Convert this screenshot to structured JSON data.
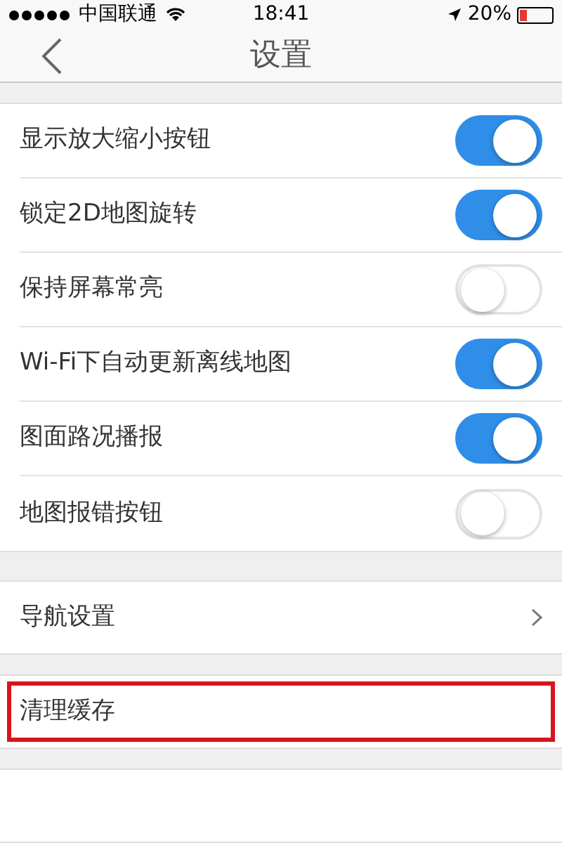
{
  "status_bar": {
    "carrier": "中国联通",
    "time": "18:41",
    "battery": "20%"
  },
  "nav": {
    "title": "设置"
  },
  "toggles": [
    {
      "label": "显示放大缩小按钮",
      "on": true
    },
    {
      "label": "锁定2D地图旋转",
      "on": true
    },
    {
      "label": "保持屏幕常亮",
      "on": false
    },
    {
      "label": "Wi-Fi下自动更新离线地图",
      "on": true
    },
    {
      "label": "图面路况播报",
      "on": true
    },
    {
      "label": "地图报错按钮",
      "on": false
    }
  ],
  "sections": [
    {
      "items": [
        {
          "label": "导航设置",
          "kind": "link",
          "highlighted": false
        }
      ]
    },
    {
      "items": [
        {
          "label": "清理缓存",
          "kind": "plain",
          "highlighted": true
        }
      ]
    },
    {
      "items": [
        {
          "kind": "blank",
          "highlighted": false
        }
      ]
    }
  ]
}
